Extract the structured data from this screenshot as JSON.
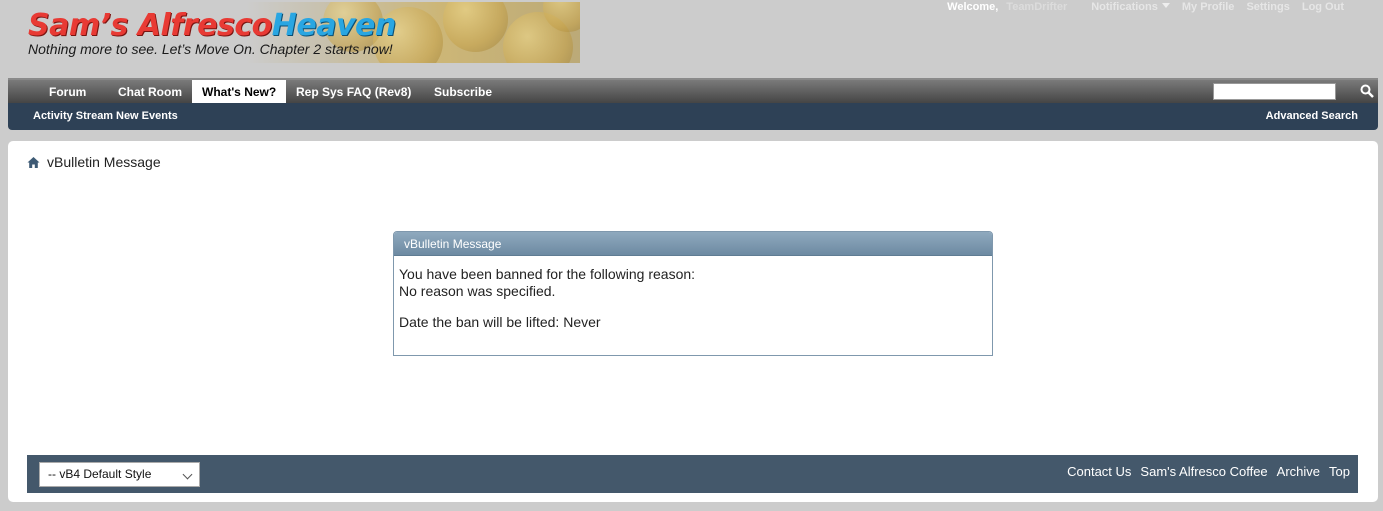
{
  "header": {
    "logo_title_red": "Sam’s Alfresco",
    "logo_title_blue": "Heaven",
    "logo_tagline": "Nothing more to see. Let’s Move On. Chapter 2 starts now!"
  },
  "toplinks": {
    "welcome": "Welcome,",
    "username": "TeamDrifter",
    "notifications": "Notifications",
    "my_profile": "My Profile",
    "settings": "Settings",
    "log_out": "Log Out"
  },
  "navbar": {
    "tabs": [
      {
        "label": "Forum"
      },
      {
        "label": "Chat Room"
      },
      {
        "label": "What's New?"
      },
      {
        "label": "Rep Sys FAQ (Rev8)"
      },
      {
        "label": "Subscribe"
      }
    ],
    "search_value": ""
  },
  "subnav": {
    "activity_stream": "Activity Stream",
    "new_events": "New Events",
    "advanced_search": "Advanced Search"
  },
  "breadcrumb": {
    "title": "vBulletin Message"
  },
  "message": {
    "heading": "vBulletin Message",
    "line1": "You have been banned for the following reason:",
    "line2": "No reason was specified.",
    "line3": "Date the ban will be lifted: Never"
  },
  "footer": {
    "style_selected": "-- vB4 Default Style",
    "links": [
      "Contact Us",
      "Sam's Alfresco Coffee",
      "Archive",
      "Top"
    ]
  },
  "colors": {
    "page_bg": "#cccccc",
    "subnav_bg": "#2e4156",
    "footer_bg": "#44586b",
    "message_header": "#7f98ad"
  }
}
